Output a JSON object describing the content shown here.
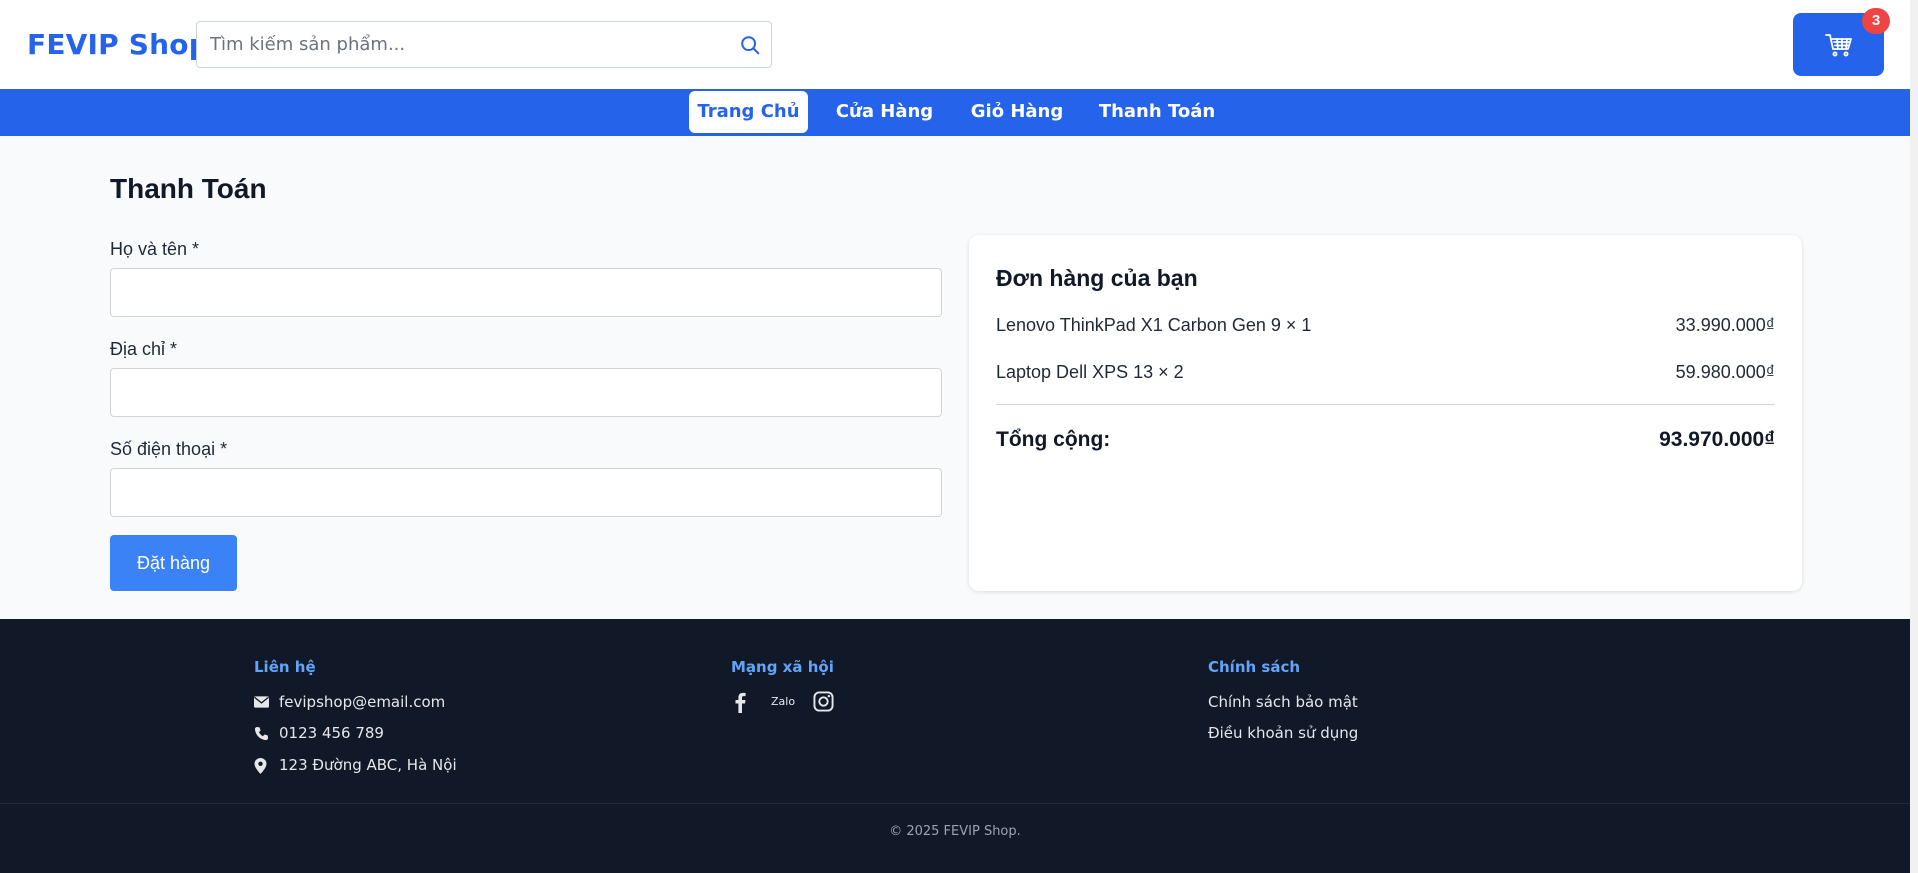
{
  "header": {
    "brand": "FEVIP Shop",
    "search_placeholder": "Tìm kiếm sản phẩm...",
    "cart_count": "3",
    "brand_color": "#2563eb"
  },
  "nav": {
    "items": [
      {
        "label": "Trang Chủ",
        "active": true
      },
      {
        "label": "Cửa Hàng",
        "active": false
      },
      {
        "label": "Giỏ Hàng",
        "active": false
      },
      {
        "label": "Thanh Toán",
        "active": false
      }
    ]
  },
  "checkout": {
    "title": "Thanh Toán",
    "fields": [
      {
        "label": "Họ và tên *",
        "value": ""
      },
      {
        "label": "Địa chỉ *",
        "value": ""
      },
      {
        "label": "Số điện thoại *",
        "value": ""
      }
    ],
    "submit_label": "Đặt hàng"
  },
  "summary": {
    "title": "Đơn hàng của bạn",
    "items": [
      {
        "name": "Lenovo ThinkPad X1 Carbon Gen 9 × 1",
        "price": "33.990.000₫"
      },
      {
        "name": "Laptop Dell XPS 13 × 2",
        "price": "59.980.000₫"
      }
    ],
    "total_label": "Tổng cộng:",
    "total_value": "93.970.000₫"
  },
  "footer": {
    "contact": {
      "heading": "Liên hệ",
      "email": "fevipshop@email.com",
      "phone": "0123 456 789",
      "address": "123 Đường ABC, Hà Nội"
    },
    "social": {
      "heading": "Mạng xã hội",
      "zalo_label": "Zalo",
      "icons": [
        "facebook-icon",
        "zalo-icon",
        "instagram-icon"
      ]
    },
    "policy": {
      "heading": "Chính sách",
      "links": [
        "Chính sách bảo mật",
        "Điều khoản sử dụng"
      ]
    },
    "copyright": "© 2025 FEVIP Shop."
  }
}
